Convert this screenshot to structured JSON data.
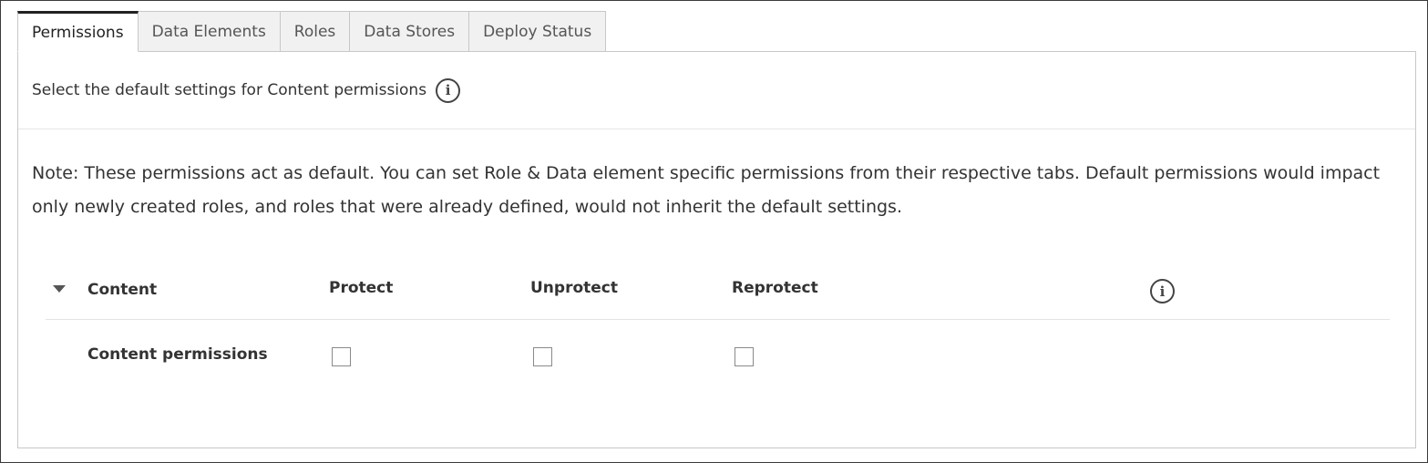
{
  "tabs": [
    {
      "label": "Permissions",
      "active": true
    },
    {
      "label": "Data Elements",
      "active": false
    },
    {
      "label": "Roles",
      "active": false
    },
    {
      "label": "Data Stores",
      "active": false
    },
    {
      "label": "Deploy Status",
      "active": false
    }
  ],
  "header": {
    "text": "Select the default settings for Content permissions",
    "icon": "info-icon"
  },
  "note": "Note: These permissions act as default. You can set Role & Data element specific permissions from their respective tabs. Default permissions would impact only newly created roles, and roles that were already defined, would not inherit the default settings.",
  "table": {
    "columns": {
      "content": "Content",
      "protect": "Protect",
      "unprotect": "Unprotect",
      "reprotect": "Reprotect",
      "info_icon": "info-icon"
    },
    "rows": [
      {
        "label": "Content permissions",
        "protect": false,
        "unprotect": false,
        "reprotect": false
      }
    ]
  }
}
